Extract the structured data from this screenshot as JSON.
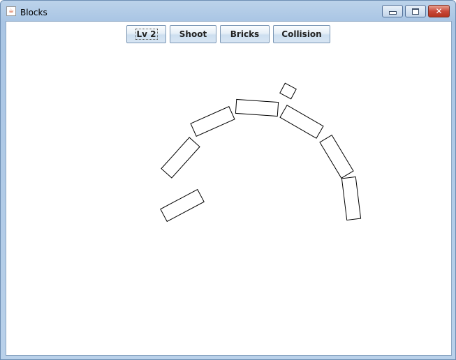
{
  "window": {
    "title": "Blocks",
    "icon": "java-cup-icon",
    "controls": [
      "minimize-icon",
      "maximize-icon",
      "close-icon"
    ]
  },
  "toolbar": {
    "level_label": "Lv 2",
    "shoot_label": "Shoot",
    "bricks_label": "Bricks",
    "collision_label": "Collision"
  },
  "colors": {
    "canvas_background": "#ffffff",
    "block_outline": "#000000"
  }
}
